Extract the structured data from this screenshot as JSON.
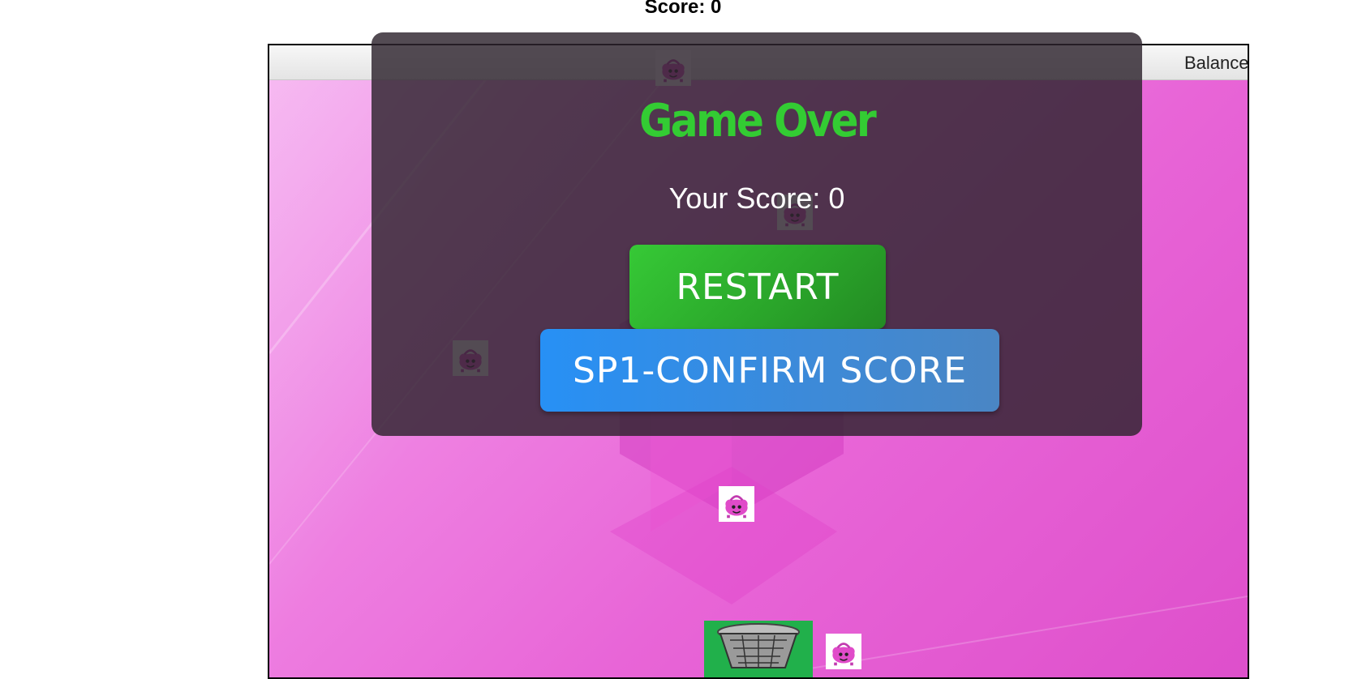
{
  "game": {
    "score_text": "Score: 0",
    "balance_label": "Balance",
    "colors": {
      "background": "#e865d7",
      "title_green": "#33cc33",
      "restart_green": "#2aa52a",
      "confirm_blue": "#2790f5",
      "basket_green": "#21b04b"
    },
    "falling_items_icon": "pink-bag-icon",
    "catcher_icon": "basket-icon"
  },
  "game_over": {
    "title": "Game Over",
    "score_text": "Your Score: 0",
    "restart_label": "RESTART",
    "confirm_label": "SP1-CONFIRM SCORE"
  }
}
